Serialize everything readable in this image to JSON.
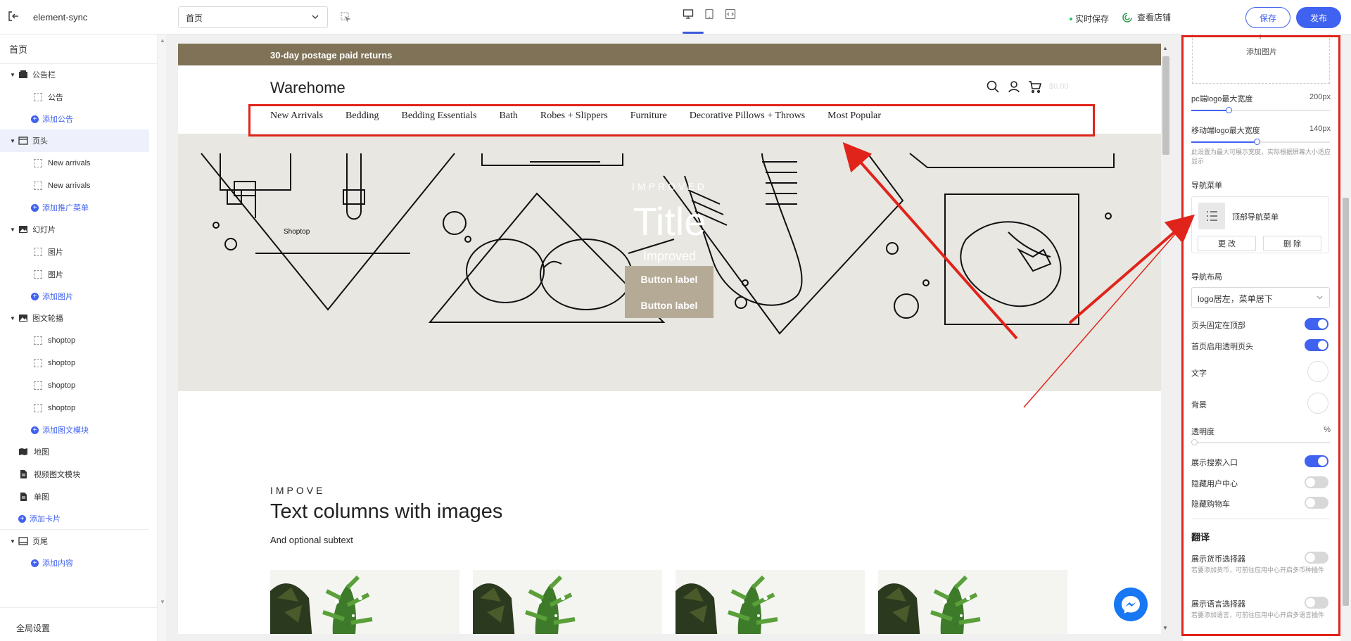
{
  "topbar": {
    "app_name": "element-sync",
    "page_select_value": "首页",
    "autosave_label": "实时保存",
    "view_store_label": "查看店铺",
    "save_label": "保存",
    "publish_label": "发布"
  },
  "sidebar": {
    "title": "首页",
    "sections": {
      "announcement": {
        "label": "公告栏",
        "items": [
          "公告"
        ],
        "add_label": "添加公告"
      },
      "header": {
        "label": "页头",
        "items": [
          "New arrivals",
          "New arrivals"
        ],
        "add_label": "添加推广菜单"
      },
      "slideshow": {
        "label": "幻灯片",
        "items": [
          "图片",
          "图片"
        ],
        "add_label": "添加图片"
      },
      "carousel": {
        "label": "图文轮播",
        "items": [
          "shoptop",
          "shoptop",
          "shoptop",
          "shoptop"
        ],
        "add_label": "添加图文模块"
      },
      "map": {
        "label": "地图"
      },
      "video": {
        "label": "视频图文模块"
      },
      "single": {
        "label": "单图"
      },
      "add_card_label": "添加卡片",
      "footer": {
        "label": "页尾",
        "add_label": "添加内容"
      }
    },
    "global_settings_label": "全局设置"
  },
  "preview": {
    "announcement_text": "30-day postage paid returns",
    "store_name": "Warehome",
    "cart_amount": "$0.00",
    "nav": [
      "New Arrivals",
      "Bedding",
      "Bedding Essentials",
      "Bath",
      "Robes + Slippers",
      "Furniture",
      "Decorative Pillows + Throws",
      "Most Popular"
    ],
    "hero": {
      "eyebrow": "IMPROVED",
      "title": "Title",
      "subtitle": "Improved",
      "button1": "Button label",
      "button2": "Button label",
      "bag_brand": "Shoptop"
    },
    "text_section": {
      "eyebrow": "IMPOVE",
      "title": "Text columns with images",
      "subtitle": "And optional subtext"
    }
  },
  "panel": {
    "add_image_label": "添加图片",
    "pc_logo_label": "pc端logo最大宽度",
    "pc_logo_value": "200px",
    "pc_logo_fraction": 0.27,
    "mobile_logo_label": "移动端logo最大宽度",
    "mobile_logo_value": "140px",
    "mobile_logo_fraction": 0.47,
    "logo_hint": "此设置为最大可展示宽度，实际根据屏幕大小适应显示",
    "nav_menu_label": "导航菜单",
    "nav_menu_name": "顶部导航菜单",
    "change_label": "更 改",
    "delete_label": "删 除",
    "nav_layout_label": "导航布局",
    "nav_layout_value": "logo居左，菜单居下",
    "fixed_header_label": "页头固定在顶部",
    "fixed_header_on": true,
    "transparent_header_label": "首页启用透明页头",
    "transparent_header_on": true,
    "text_color_label": "文字",
    "bg_color_label": "背景",
    "opacity_label": "透明度",
    "opacity_unit": "%",
    "opacity_fraction": 0.0,
    "show_search_label": "展示搜索入口",
    "show_search_on": true,
    "hide_user_label": "隐藏用户中心",
    "hide_user_on": false,
    "hide_cart_label": "隐藏购物车",
    "hide_cart_on": false,
    "translate_heading": "翻译",
    "currency_label": "展示货币选择器",
    "currency_on": false,
    "currency_hint": "若要添加货币，可前往应用中心开启多币种插件",
    "language_label": "展示语言选择器",
    "language_on": false,
    "language_hint": "若要添加语言，可前往应用中心开启多语言插件"
  },
  "colors": {
    "accent": "#4062f0",
    "announcement_bg": "#7f7256",
    "annotation": "#e0241b",
    "hero_bg": "#e8e7e2"
  }
}
